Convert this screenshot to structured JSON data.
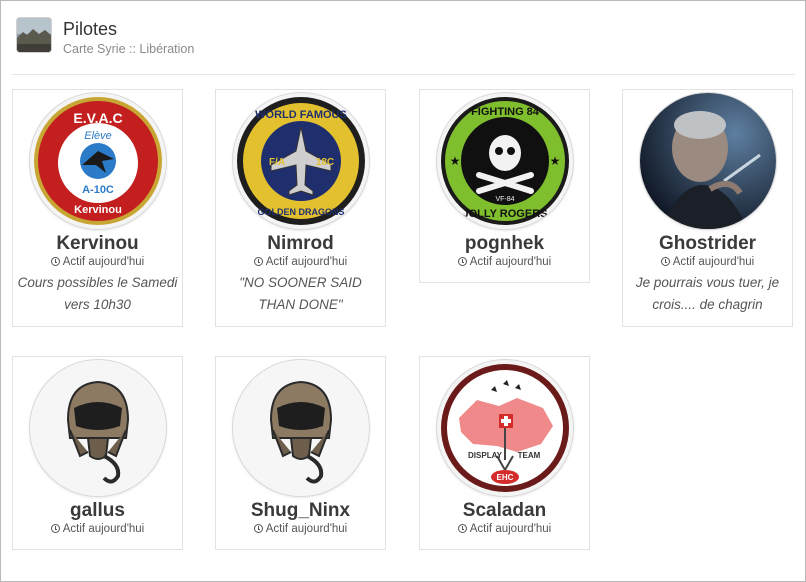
{
  "header": {
    "title": "Pilotes",
    "breadcrumb": "Carte Syrie :: Libération",
    "thumb_icon": "landscape-thumbnail-icon"
  },
  "pilots": [
    {
      "name": "Kervinou",
      "status": "Actif aujourd'hui",
      "quote": "Cours possibles le Samedi vers 10h30",
      "avatar": "eva-c-a10c-badge",
      "badge_text": [
        "E.V.A.C",
        "Elève",
        "A-10C",
        "Kervinou"
      ]
    },
    {
      "name": "Nimrod",
      "status": "Actif aujourd'hui",
      "quote": "\"NO SOONER SAID THAN DONE\"",
      "avatar": "golden-dragons-patch",
      "badge_text": [
        "WORLD FAMOUS",
        "GOLDEN DRAGONS",
        "F/A",
        "18C"
      ]
    },
    {
      "name": "pognhek",
      "status": "Actif aujourd'hui",
      "quote": "",
      "avatar": "jolly-rogers-patch",
      "badge_text": [
        "FIGHTING 84",
        "JOLLY ROGERS",
        "VF-84"
      ]
    },
    {
      "name": "Ghostrider",
      "status": "Actif aujourd'hui",
      "quote": "Je pourrais vous tuer, je crois.... de chagrin",
      "avatar": "portrait-photo",
      "badge_text": []
    },
    {
      "name": "gallus",
      "status": "Actif aujourd'hui",
      "quote": "",
      "avatar": "pilot-helmet-icon",
      "badge_text": []
    },
    {
      "name": "Shug_Ninx",
      "status": "Actif aujourd'hui",
      "quote": "",
      "avatar": "pilot-helmet-icon",
      "badge_text": []
    },
    {
      "name": "Scaladan",
      "status": "Actif aujourd'hui",
      "quote": "",
      "avatar": "display-team-patch",
      "badge_text": [
        "DISPLAY",
        "TEAM",
        "EHC"
      ]
    }
  ]
}
